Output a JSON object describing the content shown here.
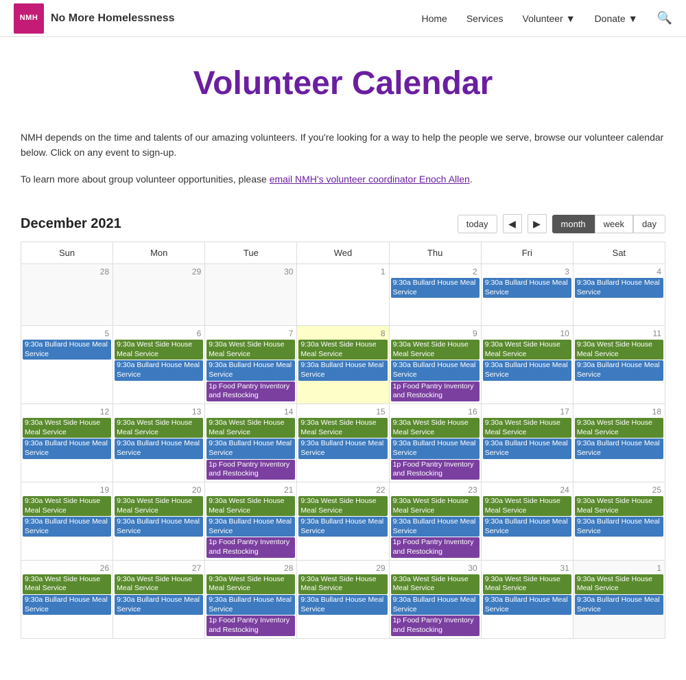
{
  "brand": {
    "logo_text": "NMH",
    "name": "No More Homelessness"
  },
  "nav": {
    "home": "Home",
    "services": "Services",
    "volunteer": "Volunteer",
    "donate": "Donate"
  },
  "page": {
    "title": "Volunteer Calendar",
    "intro1": "NMH depends on the time and talents of our amazing volunteers. If you're looking for a way to help the people we serve, browse our volunteer calendar below. Click on any event to sign-up.",
    "intro2_prefix": "To learn more about group volunteer opportunities, please ",
    "intro2_link": "email NMH's volunteer coordinator Enoch Allen",
    "intro2_suffix": "."
  },
  "calendar": {
    "month_title": "December 2021",
    "btn_today": "today",
    "btn_month": "month",
    "btn_week": "week",
    "btn_day": "day",
    "days": [
      "Sun",
      "Mon",
      "Tue",
      "Wed",
      "Thu",
      "Fri",
      "Sat"
    ],
    "events": {
      "bullard": "9:30a Bullard House Meal Service",
      "westside": "9:30a West Side House Meal Service",
      "foodpantry": "1p Food Pantry Inventory and Restocking"
    }
  }
}
